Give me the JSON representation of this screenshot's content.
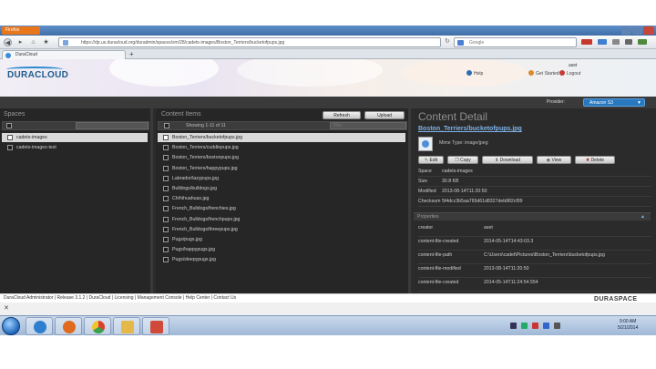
{
  "browser": {
    "app_menu": "Firefox",
    "url": "https://dp.us.duracloud.org/duradmin/spaces/sm/28/cadets-images/Boston_Terriers/bucketofpups.jpg",
    "search_engine": "Google",
    "tab_title": "DuraCloud",
    "new_tab": "+"
  },
  "header": {
    "logo": "DURACLOUD",
    "user": "aset",
    "links": [
      "Help",
      "Get Started",
      "Logout"
    ],
    "provider_label": "Provider:",
    "provider_value": "Amazon S3"
  },
  "spaces": {
    "title": "Spaces",
    "items": [
      {
        "label": "cadets-images",
        "selected": true
      },
      {
        "label": "cadets-images-test",
        "selected": false
      }
    ]
  },
  "content": {
    "title": "Content Items",
    "refresh_label": "Refresh",
    "upload_label": "Upload",
    "showing": "Showing 1-11 of 11",
    "filter_placeholder": "filter",
    "items": [
      {
        "label": "Boston_Terriers/bucketofpups.jpg",
        "selected": true
      },
      {
        "label": "Boston_Terriers/cuddlepups.jpg",
        "selected": false
      },
      {
        "label": "Boston_Terriers/bostonpups.jpg",
        "selected": false
      },
      {
        "label": "Boston_Terriers/happypups.jpg",
        "selected": false
      },
      {
        "label": "Labrador/lazypups.jpg",
        "selected": false
      },
      {
        "label": "Bulldogs/bulldogs.jpg",
        "selected": false
      },
      {
        "label": "Ch/hihuahuas.jpg",
        "selected": false
      },
      {
        "label": "French_Bulldogs/frenchies.jpg",
        "selected": false
      },
      {
        "label": "French_Bulldogs/frenchpups.jpg",
        "selected": false
      },
      {
        "label": "French_Bulldogs/threepups.jpg",
        "selected": false
      },
      {
        "label": "Pugs/pugs.jpg",
        "selected": false
      },
      {
        "label": "Pugs/happypugs.jpg",
        "selected": false
      },
      {
        "label": "Pugs/sleepypugs.jpg",
        "selected": false
      }
    ]
  },
  "detail": {
    "title": "Content Detail",
    "file_link": "Boston_Terriers/bucketofpups.jpg",
    "mime": "Mime Type: image/jpeg",
    "actions": [
      "Edit",
      "Copy",
      "Download",
      "View",
      "Delete"
    ],
    "fields": [
      {
        "label": "Space",
        "value": "cadets-images"
      },
      {
        "label": "Size",
        "value": "30.8 KB"
      },
      {
        "label": "Modified",
        "value": "2013-08-14T11:20:50"
      },
      {
        "label": "Checksum",
        "value": "5f4dcc3b5aa765d61d8327deb882cf99"
      }
    ],
    "properties_title": "Properties",
    "properties": [
      {
        "label": "creator",
        "value": "aset"
      },
      {
        "label": "content-file-created",
        "value": "2014-05-14T14:43:03.3"
      },
      {
        "label": "content-file-path",
        "value": "C:\\Users\\cadet\\Pictures\\Boston_Terriers\\bucketofpups.jpg"
      },
      {
        "label": "content-file-modified",
        "value": "2013-08-14T11:20:50"
      },
      {
        "label": "content-file-created",
        "value": "2014-05-14T11:24:54.554"
      }
    ]
  },
  "footer": {
    "text": "DuraCloud Administrator | Release 3.1.2 | DuraCloud | Licensing | Management Console | Help Center | Contact Us",
    "logo": "DURASPACE"
  },
  "taskbar": {
    "time": "9:00 AM",
    "date": "5/21/2014"
  }
}
